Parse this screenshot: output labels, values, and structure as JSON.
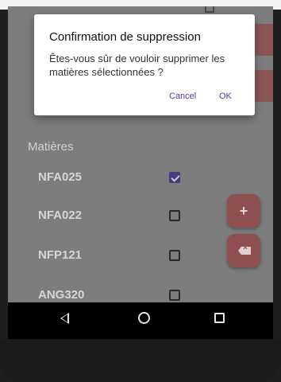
{
  "dialog": {
    "title": "Confirmation de suppression",
    "message": "Êtes-vous sûr de vouloir supprimer les matières sélectionnées ?",
    "cancel_label": "Cancel",
    "ok_label": "OK"
  },
  "content": {
    "section_title": "Matières",
    "items": [
      {
        "code": "NFA025",
        "checked": true
      },
      {
        "code": "NFA022",
        "checked": false
      },
      {
        "code": "NFP121",
        "checked": false
      },
      {
        "code": "ANG320",
        "checked": false
      }
    ]
  },
  "fabs": {
    "add_icon": "plus-icon",
    "delete_icon": "backspace-icon",
    "add_glyph": "+"
  },
  "navbar": {
    "back_icon": "back-triangle-icon",
    "home_icon": "home-circle-icon",
    "recents_icon": "recents-square-icon"
  },
  "colors": {
    "accent": "#5a3a9a",
    "fab": "#8d4f4f",
    "scrim": "#7d7d7d"
  }
}
